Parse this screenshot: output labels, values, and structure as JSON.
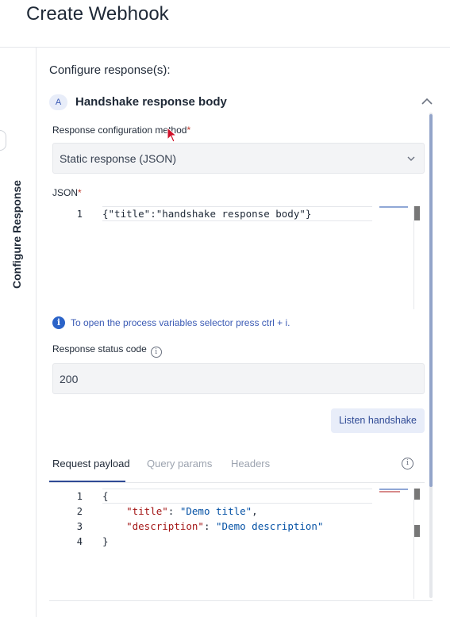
{
  "header": {
    "title": "Create Webhook"
  },
  "side_tab": {
    "label": "Configure Response"
  },
  "configure": {
    "title": "Configure response(s):",
    "accordion": {
      "badge": "A",
      "title": "Handshake response body"
    }
  },
  "response_method": {
    "label": "Response configuration method",
    "required_mark": "*",
    "selected": "Static response (JSON)"
  },
  "json_editor": {
    "label": "JSON",
    "required_mark": "*",
    "line_numbers": [
      "1"
    ],
    "lines": [
      "{\"title\":\"handshake response body\"}"
    ]
  },
  "info": {
    "text": "To open the process variables selector press ctrl + i."
  },
  "status_code": {
    "label": "Response status code",
    "help": "i",
    "value": "200"
  },
  "listen_button": {
    "label": "Listen handshake"
  },
  "tabs": [
    {
      "label": "Request payload",
      "active": true
    },
    {
      "label": "Query params",
      "active": false
    },
    {
      "label": "Headers",
      "active": false
    }
  ],
  "tab_info": "i",
  "payload_editor": {
    "line_numbers": [
      "1",
      "2",
      "3",
      "4"
    ],
    "line1": "{",
    "line2_key": "\"title\"",
    "line2_sep": ": ",
    "line2_val": "\"Demo title\"",
    "line2_end": ",",
    "line3_key": "\"description\"",
    "line3_sep": ": ",
    "line3_val": "\"Demo description\"",
    "line4": "}"
  },
  "colors": {
    "accent": "#2f4a95",
    "badge_bg": "#e8edf9",
    "info_blue": "#2b63c8"
  }
}
